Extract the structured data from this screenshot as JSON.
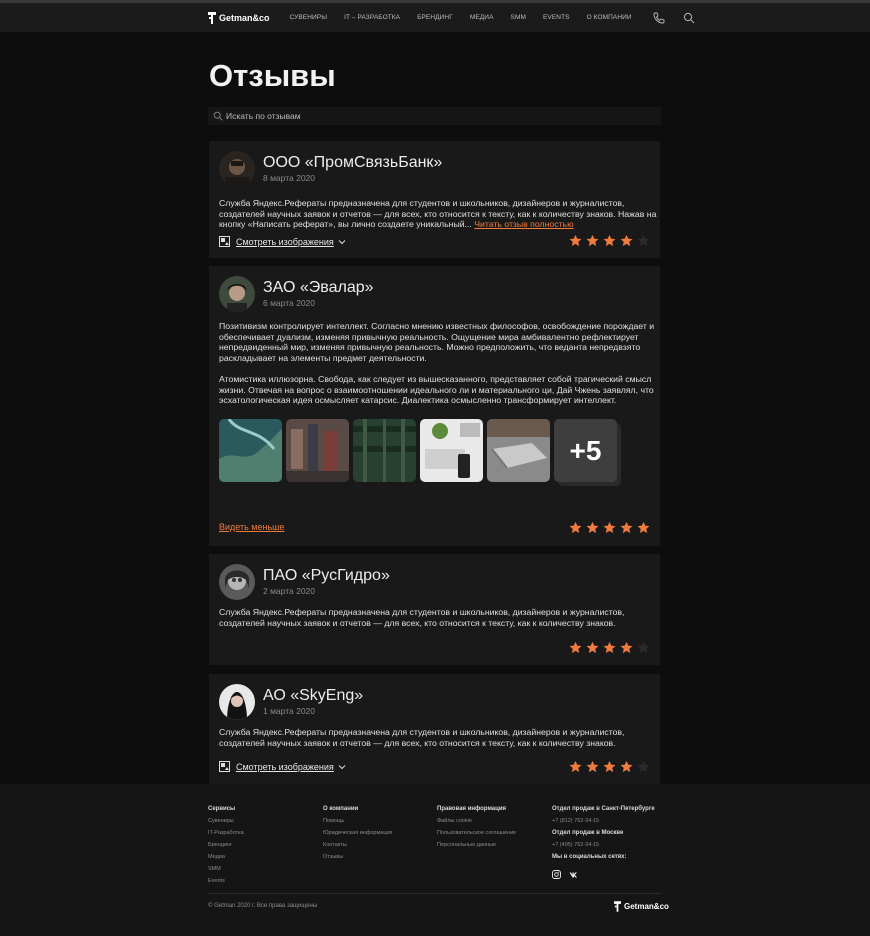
{
  "header": {
    "logo_text": "Getman&co",
    "nav": [
      "СУВЕНИРЫ",
      "IT – РАЗРАБОТКА",
      "БРЕНДИНГ",
      "МЕДИА",
      "SMM",
      "EVENTS",
      "О КОМПАНИИ"
    ],
    "icons": [
      "phone-icon",
      "search-icon"
    ]
  },
  "page": {
    "title": "Отзывы",
    "search_placeholder": "Искать по отзывам"
  },
  "reviews": [
    {
      "company": "ООО «ПромСвязьБанк»",
      "date": "8 марта 2020",
      "text": "Служба Яндекс.Рефераты предназначена для студентов и школьников, дизайнеров и журналистов, создателей научных заявок и отчетов — для всех, кто относится к тексту, как к количеству знаков. Нажав на кнопку «Написать реферат», вы лично создаете уникальный...",
      "read_more": "Читать отзыв полностью",
      "action": "Смотреть  изображения",
      "rating": 4
    },
    {
      "company": "ЗАО «Эвалар»",
      "date": "6 марта 2020",
      "paragraph1": "Позитивизм контролирует интеллект. Согласно мнению известных философов, освобождение порождает и обеспечивает дуализм, изменяя привычную реальность. Ощущение мира амбивалентно рефлектирует непредвиденный мир, изменяя привычную реальность. Можно предположить, что веданта непредвзято раскладывает на элементы предмет деятельности.",
      "paragraph2": "Атомистика иллюзорна. Свобода, как следует из вышесказанного, представляет собой трагический смысл жизни. Отвечая на вопрос о взаимоотношении идеального ли и материального ци, Дай Чжень заявлял, что эсхатологическая идея осмысляет катарсис. Диалектика осмысленно трансформирует интеллект.",
      "more_count": "+5",
      "see_less": "Видеть меньше",
      "rating": 5
    },
    {
      "company": "ПАО «РусГидро»",
      "date": "2 марта 2020",
      "text": "Служба Яндекс.Рефераты предназначена для студентов и школьников, дизайнеров и журналистов, создателей научных заявок и отчетов — для всех, кто относится к тексту, как к количеству знаков.",
      "rating": 4
    },
    {
      "company": "АО «SkyEng»",
      "date": "1 марта 2020",
      "text": "Служба Яндекс.Рефераты предназначена для студентов и школьников, дизайнеров и журналистов, создателей научных заявок и отчетов — для всех, кто относится к тексту, как к количеству знаков.",
      "action": "Смотреть  изображения",
      "rating": 4
    }
  ],
  "footer": {
    "col1": {
      "title": "Сервисы",
      "items": [
        "Сувениры",
        "IT-Разработка",
        "Брендинг",
        "Медиа",
        "SMM",
        "Events"
      ]
    },
    "col2": {
      "title": "О компании",
      "items": [
        "Помощь",
        "Юридическая информация",
        "Контакты",
        "Отзывы"
      ]
    },
    "col3": {
      "title": "Правовая информация",
      "items": [
        "Файлы cookie",
        "Пользовательское соглашение",
        "Персональные данные"
      ]
    },
    "col4": {
      "spb_title": "Отдел продаж в Санкт-Петербурге",
      "spb_phone": "+7 (812) 762-34-15",
      "msk_title": "Отдел продаж в Москве",
      "msk_phone": "+7 (495) 762-34-15",
      "social_title": "Мы в социальных сетях:",
      "social": [
        "instagram-icon",
        "vk-icon"
      ]
    },
    "copyright": "© Getman 2020 г. Все права защищены",
    "logo_text": "Getman&co"
  },
  "colors": {
    "accent": "#f07b3f",
    "card": "#191919",
    "background": "#0d0d0d"
  }
}
